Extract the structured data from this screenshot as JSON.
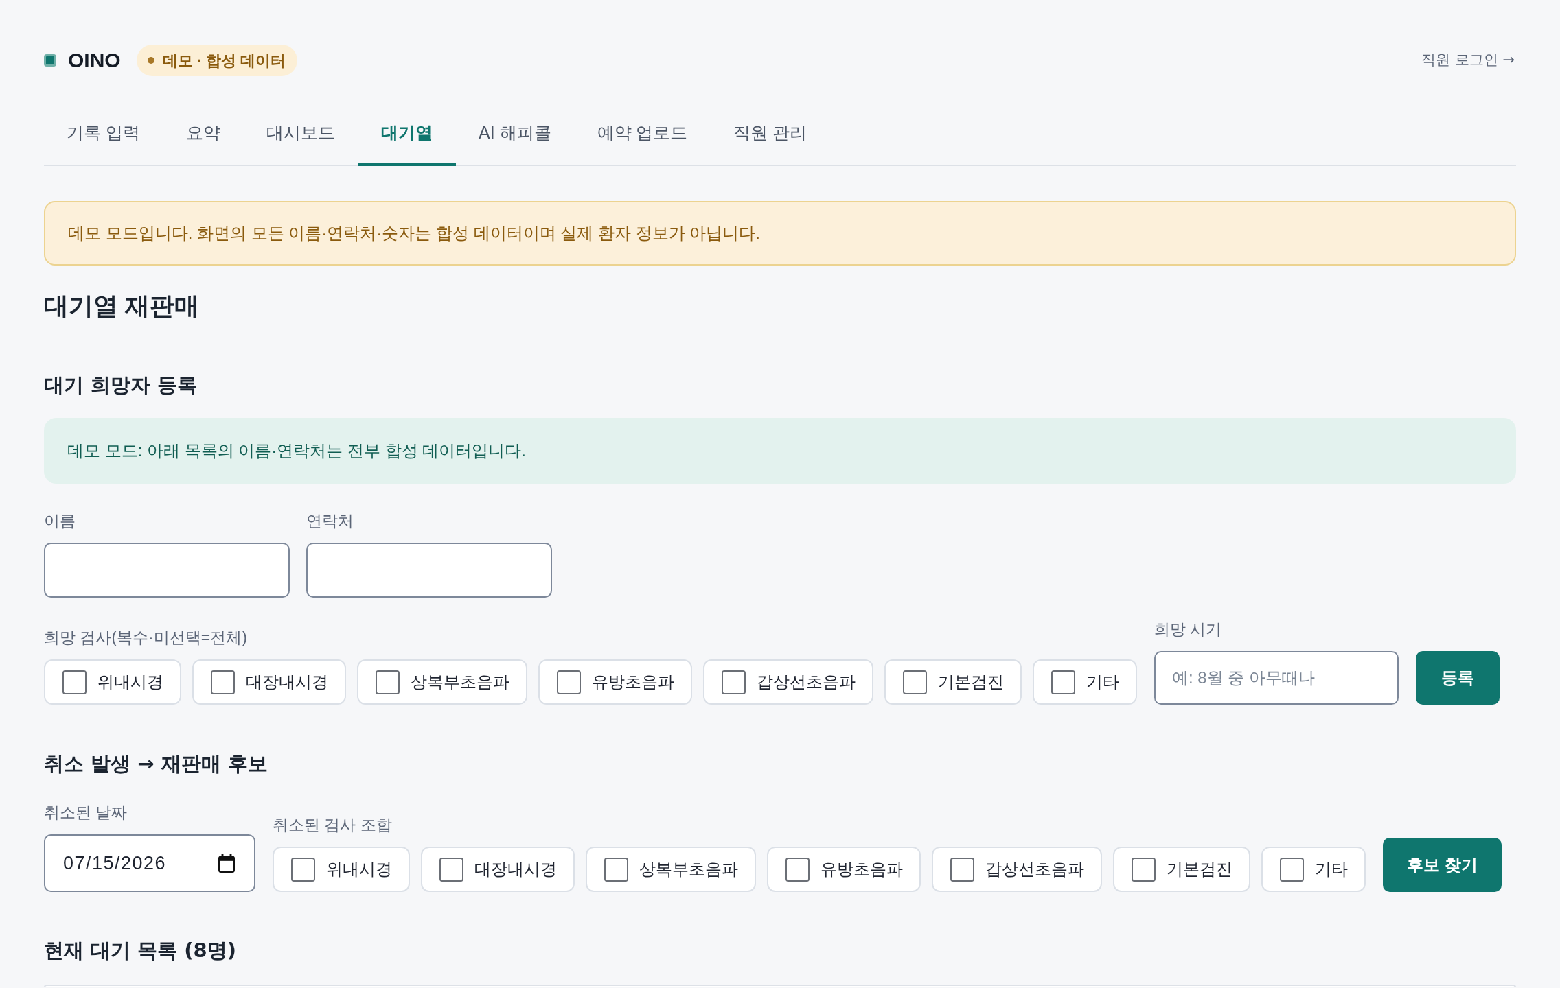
{
  "header": {
    "brand": "OINO",
    "badge": "데모 · 합성 데이터",
    "login_link": "직원 로그인 →"
  },
  "tabs": [
    {
      "label": "기록 입력",
      "selected": false
    },
    {
      "label": "요약",
      "selected": false
    },
    {
      "label": "대시보드",
      "selected": false
    },
    {
      "label": "대기열",
      "selected": true
    },
    {
      "label": "AI 해피콜",
      "selected": false
    },
    {
      "label": "예약 업로드",
      "selected": false
    },
    {
      "label": "직원 관리",
      "selected": false
    }
  ],
  "demo_notice": "데모 모드입니다. 화면의 모든 이름·연락처·숫자는 합성 데이터이며 실제 환자 정보가 아닙니다.",
  "page_title": "대기열 재판매",
  "register": {
    "title": "대기 희망자 등록",
    "notice": "데모 모드: 아래 목록의 이름·연락처는 전부 합성 데이터입니다.",
    "fields": [
      {
        "label": "이름"
      },
      {
        "label": "연락처"
      }
    ],
    "exams_label": "희망 검사(복수·미선택=전체)",
    "exams": [
      {
        "label": "위내시경",
        "checked": false
      },
      {
        "label": "대장내시경",
        "checked": false
      },
      {
        "label": "상복부초음파",
        "checked": false
      },
      {
        "label": "유방초음파",
        "checked": false
      },
      {
        "label": "갑상선초음파",
        "checked": false
      },
      {
        "label": "기본검진",
        "checked": false
      },
      {
        "label": "기타",
        "checked": false
      }
    ],
    "timing": {
      "label": "희망 시기",
      "placeholder": "예: 8월 중 아무때나"
    },
    "submit": "등록"
  },
  "cancel": {
    "title": "취소 발생 → 재판매 후보",
    "date": {
      "label": "취소된 날짜",
      "value": "07/15/2026"
    },
    "exams_label": "취소된 검사 조합",
    "exams": [
      {
        "label": "위내시경",
        "checked": false
      },
      {
        "label": "대장내시경",
        "checked": false
      },
      {
        "label": "상복부초음파",
        "checked": false
      },
      {
        "label": "유방초음파",
        "checked": false
      },
      {
        "label": "갑상선초음파",
        "checked": false
      },
      {
        "label": "기본검진",
        "checked": false
      },
      {
        "label": "기타",
        "checked": false
      }
    ],
    "submit": "후보 찾기"
  },
  "waitlist": {
    "title": "현재 대기 목록 (8명)"
  }
}
